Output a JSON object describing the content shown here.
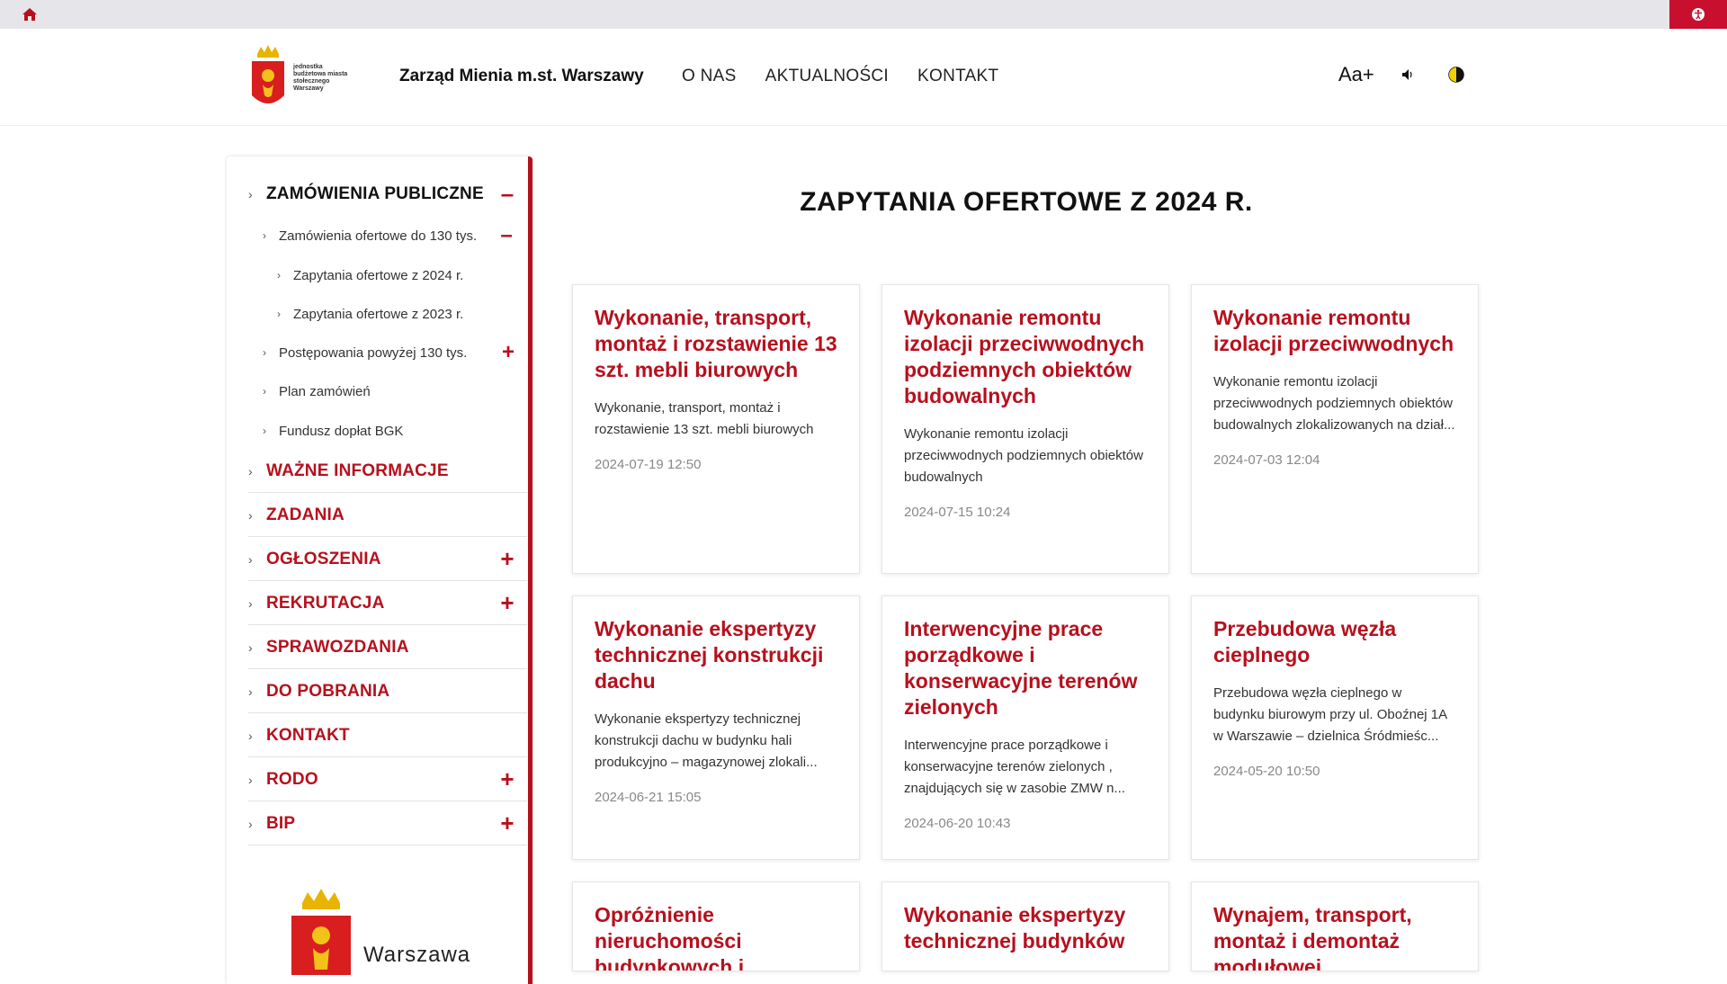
{
  "header": {
    "logo_text": "jednostka budżetowa miasta stołecznego Warszawy",
    "site_name": "Zarząd Mienia m.st. Warszawy",
    "nav": [
      "O NAS",
      "AKTUALNOŚCI",
      "KONTAKT"
    ],
    "font_tool": "Aa+"
  },
  "sidebar": {
    "section": "ZAMÓWIENIA PUBLICZNE",
    "sub1": "Zamówienia ofertowe do 130 tys.",
    "sub1_children": [
      "Zapytania ofertowe z 2024 r.",
      "Zapytania ofertowe z 2023 r."
    ],
    "sub_items": [
      "Postępowania powyżej 130 tys.",
      "Plan zamówień",
      "Fundusz dopłat BGK"
    ],
    "main_items": [
      "WAŻNE INFORMACJE",
      "ZADANIA",
      "OGŁOSZENIA",
      "REKRUTACJA",
      "SPRAWOZDANIA",
      "DO POBRANIA",
      "KONTAKT",
      "RODO",
      "BIP"
    ],
    "warsaw_label": "Warszawa"
  },
  "main": {
    "title": "ZAPYTANIA OFERTOWE Z 2024 R.",
    "cards": [
      {
        "title": "Wykonanie, transport, montaż i rozstawienie 13 szt. mebli biurowych",
        "desc": "Wykonanie, transport, montaż i rozstawienie 13 szt. mebli biurowych",
        "date": "2024-07-19 12:50"
      },
      {
        "title": "Wykonanie remontu izolacji przeciwwodnych podziemnych obiektów budowalnych",
        "desc": "Wykonanie remontu izolacji przeciwwodnych podziemnych obiektów budowalnych",
        "date": "2024-07-15 10:24"
      },
      {
        "title": "Wykonanie remontu izolacji przeciwwodnych",
        "desc": "Wykonanie remontu izolacji przeciwwodnych podziemnych obiektów budowalnych zlokalizowanych na dział...",
        "date": "2024-07-03 12:04"
      },
      {
        "title": "Wykonanie ekspertyzy technicznej konstrukcji dachu",
        "desc": "Wykonanie ekspertyzy technicznej konstrukcji dachu w budynku hali produkcyjno – magazynowej zlokali...",
        "date": "2024-06-21 15:05"
      },
      {
        "title": "Interwencyjne prace porządkowe i konserwacyjne terenów zielonych",
        "desc": "Interwencyjne prace porządkowe i konserwacyjne terenów zielonych , znajdujących się w zasobie ZMW n...",
        "date": "2024-06-20 10:43"
      },
      {
        "title": "Przebudowa węzła cieplnego",
        "desc": "Przebudowa węzła cieplnego w budynku biurowym przy ul. Oboźnej 1A w Warszawie – dzielnica Śródmieśc...",
        "date": "2024-05-20 10:50"
      },
      {
        "title": "Opróżnienie nieruchomości budynkowych i",
        "desc": "",
        "date": ""
      },
      {
        "title": "Wykonanie ekspertyzy technicznej budynków",
        "desc": "",
        "date": ""
      },
      {
        "title": "Wynajem, transport, montaż i demontaż modułowej",
        "desc": "",
        "date": ""
      }
    ]
  },
  "colors": {
    "accent": "#b7101d",
    "topbar": "#e6e6ea"
  }
}
